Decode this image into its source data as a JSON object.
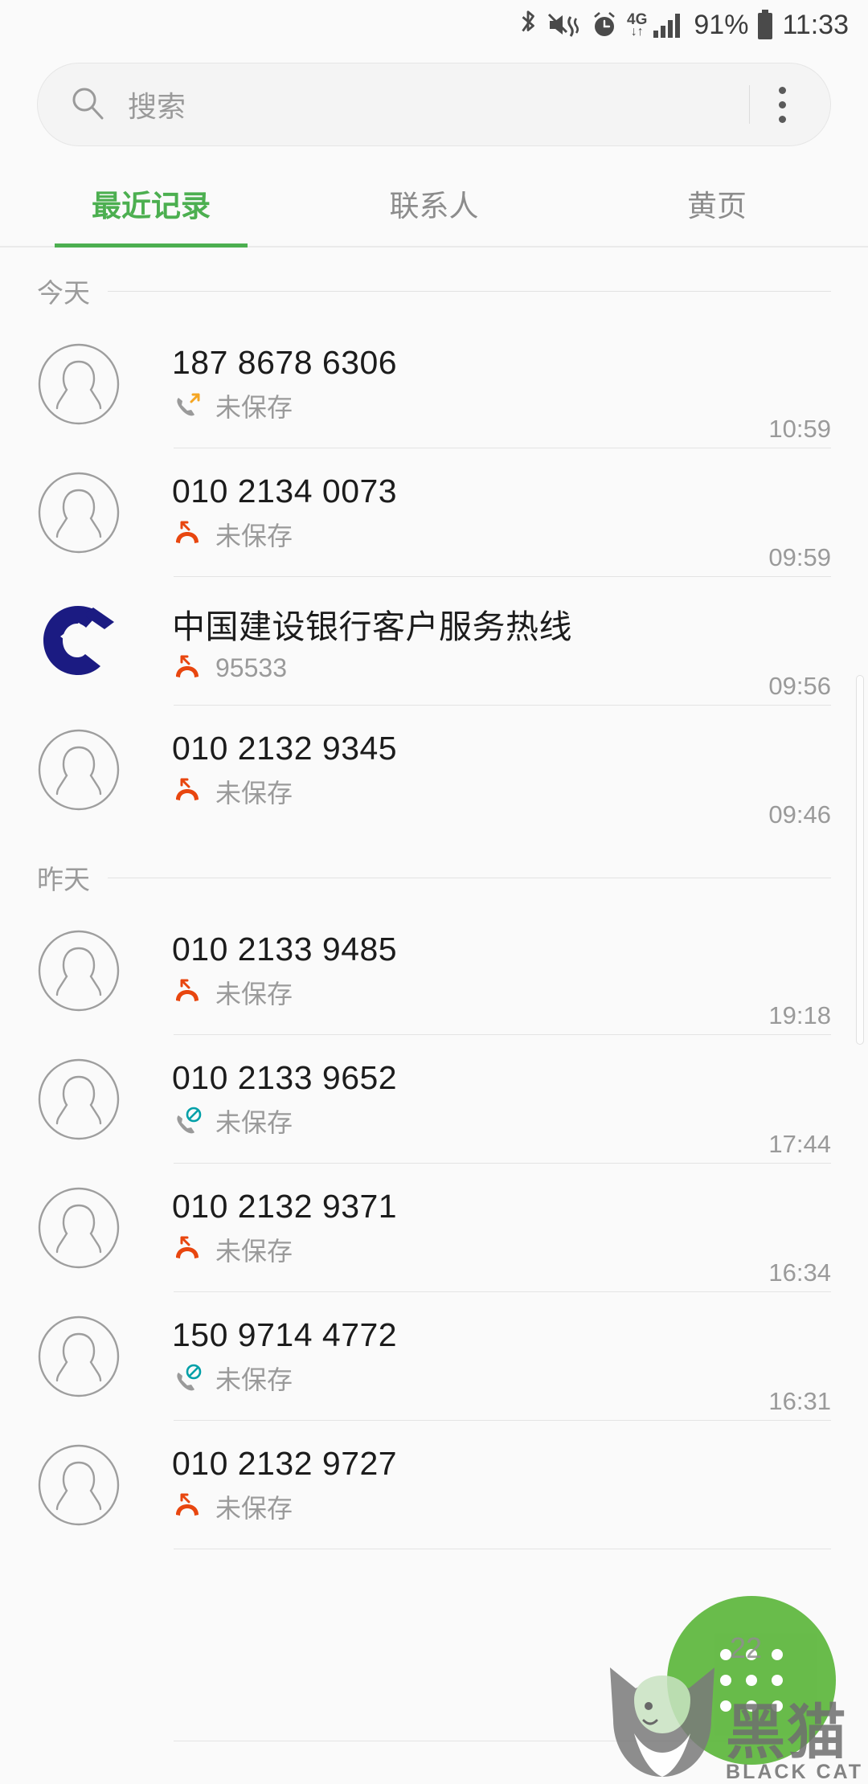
{
  "status_bar": {
    "icons": [
      "bluetooth-icon",
      "mute-vibrate-icon",
      "alarm-icon",
      "4g-data-icon",
      "signal-icon"
    ],
    "network_label": "4G",
    "battery_percent": "91%",
    "time": "11:33"
  },
  "search": {
    "placeholder": "搜索",
    "value": "",
    "icon": "search-icon",
    "overflow_icon": "kebab-menu-icon"
  },
  "tabs": [
    {
      "label": "最近记录",
      "active": true
    },
    {
      "label": "联系人",
      "active": false
    },
    {
      "label": "黄页",
      "active": false
    }
  ],
  "accent_color": "#4caf50",
  "sections": [
    {
      "label": "今天",
      "rows": [
        {
          "name": "187 8678 6306",
          "sub": "未保存",
          "time": "10:59",
          "call_type": "outgoing",
          "avatar": "person-avatar"
        },
        {
          "name": "010 2134 0073",
          "sub": "未保存",
          "time": "09:59",
          "call_type": "missed",
          "avatar": "person-avatar"
        },
        {
          "name": "中国建设银行客户服务热线",
          "sub": "95533",
          "time": "09:56",
          "call_type": "missed",
          "avatar": "ccb-logo"
        },
        {
          "name": "010 2132 9345",
          "sub": "未保存",
          "time": "09:46",
          "call_type": "missed",
          "avatar": "person-avatar"
        }
      ]
    },
    {
      "label": "昨天",
      "rows": [
        {
          "name": "010 2133 9485",
          "sub": "未保存",
          "time": "19:18",
          "call_type": "missed",
          "avatar": "person-avatar"
        },
        {
          "name": "010 2133 9652",
          "sub": "未保存",
          "time": "17:44",
          "call_type": "rejected",
          "avatar": "person-avatar"
        },
        {
          "name": "010 2132 9371",
          "sub": "未保存",
          "time": "16:34",
          "call_type": "missed",
          "avatar": "person-avatar"
        },
        {
          "name": "150 9714 4772",
          "sub": "未保存",
          "time": "16:31",
          "call_type": "rejected",
          "avatar": "person-avatar"
        },
        {
          "name": "010 2132 9727",
          "sub": "未保存",
          "time": "",
          "call_type": "missed",
          "avatar": "person-avatar"
        }
      ]
    }
  ],
  "fab": {
    "icon": "dialpad-icon",
    "color": "#5cb63c"
  },
  "watermark": {
    "cn": "黑猫",
    "en": "BLACK CAT",
    "badge": "22"
  },
  "colors": {
    "missed_call": "#e8460f",
    "outgoing_call": "#f5a623",
    "rejected_call": "#00a0a8",
    "ccb_blue": "#1b1b82"
  }
}
